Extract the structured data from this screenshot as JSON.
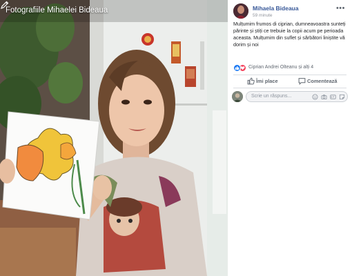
{
  "photo": {
    "album_title": "Fotografiile Mihaelei Bideaua",
    "tag_icon": "tag-pencil-icon"
  },
  "post": {
    "author": "Mihaela Bideaua",
    "time": "59 minute",
    "more_icon": "more-options-icon",
    "text": "Mulțumim frumos di ciprian, dumneavoastra sunteți părinte și știți ce trebuie la copii acum pe perioada aceasta. Mulțumim din suflet și sărbători liniștite vă dorim și noi",
    "reactions": {
      "text": "Ciprian Andrei Olteanu și alți 4",
      "icons": [
        "like-icon",
        "love-icon"
      ]
    }
  },
  "actions": {
    "like_label": "Îmi place",
    "comment_label": "Comentează"
  },
  "comment": {
    "placeholder": "Scrie un răspuns..."
  },
  "colors": {
    "link": "#385898",
    "like_blue": "#1877f2",
    "love_red": "#f33e58",
    "muted": "#90949c"
  }
}
